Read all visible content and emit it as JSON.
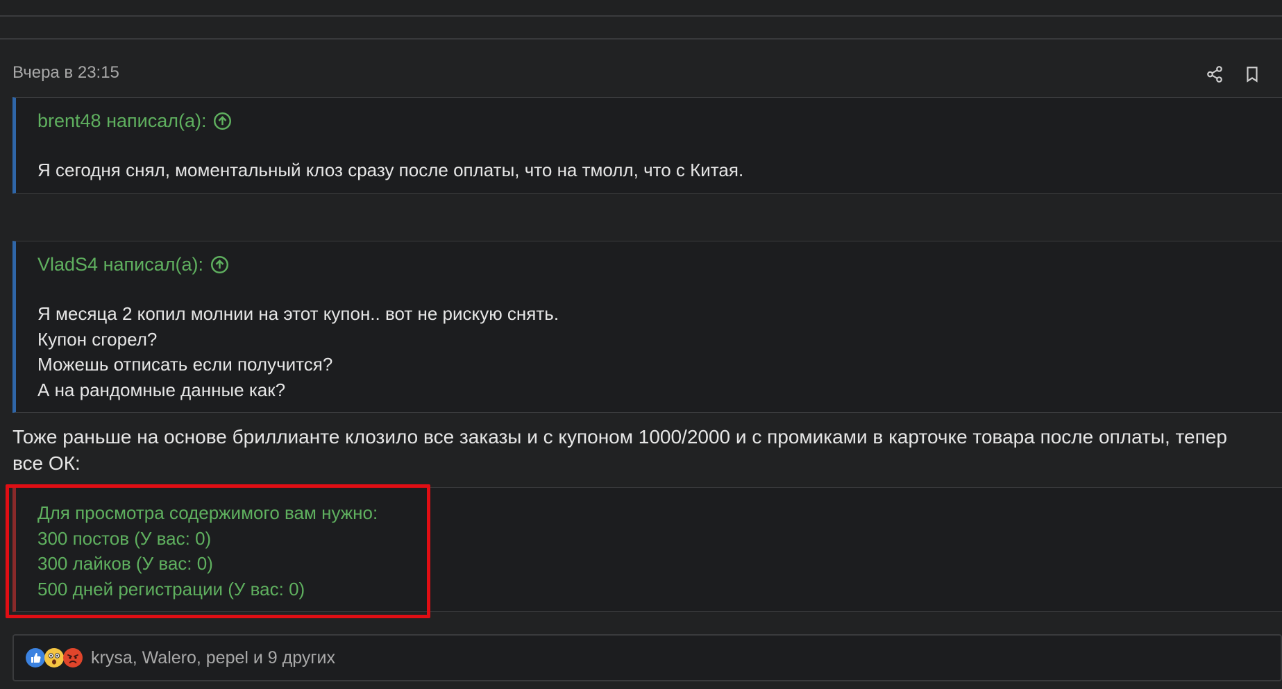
{
  "post": {
    "timestamp": "Вчера в 23:15",
    "icons": {
      "share": "share-icon",
      "bookmark": "bookmark-icon"
    }
  },
  "quotes": [
    {
      "author": "brent48 написал(а):",
      "lines": [
        "Я сегодня снял, моментальный клоз сразу после оплаты, что на тмолл, что с Китая."
      ]
    },
    {
      "author": "VladS4 написал(а):",
      "lines": [
        "Я месяца 2 копил молнии на этот купон.. вот не рискую снять.",
        "Купон сгорел?",
        "Можешь отписать если получится?",
        "А на рандомные данные как?"
      ]
    }
  ],
  "body": {
    "line1": "Тоже раньше на основе бриллианте клозило все заказы и с купоном 1000/2000 и с промиками в карточке товара после оплаты, тепер",
    "line2": "все ОК:"
  },
  "hidden": {
    "title": "Для просмотра содержимого вам нужно:",
    "requirements": [
      "300 постов (У вас: 0)",
      "300 лайков (У вас: 0)",
      "500 дней регистрации (У вас: 0)"
    ]
  },
  "reactions": {
    "text": "krysa, Walero, pepel и 9 других",
    "emojis": [
      "like-icon",
      "wow-icon",
      "angry-icon"
    ],
    "colors": {
      "like": "#3b82e0",
      "wow": "#f5c542",
      "angry": "#e0452b"
    }
  },
  "colors": {
    "background": "#212223",
    "quote_bg": "#1c1d1f",
    "quote_accent": "#2f66a8",
    "hidden_accent": "#8a2a2a",
    "green": "#5fb05f",
    "highlight": "#e00e14"
  }
}
